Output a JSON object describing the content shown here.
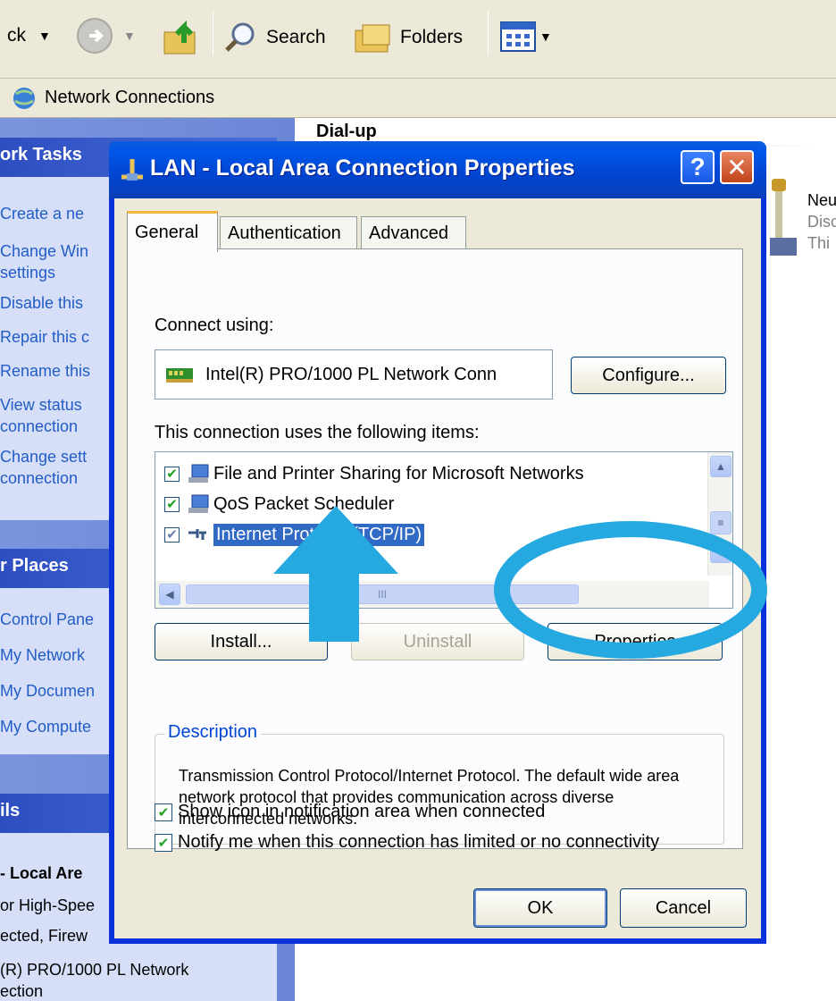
{
  "explorer": {
    "toolbar": {
      "back_label": "ck",
      "search_label": "Search",
      "folders_label": "Folders"
    },
    "address": "Network Connections",
    "taskpane": {
      "tasks_header": "ork Tasks",
      "tasks": [
        "Create a ne",
        "Change Win",
        "settings",
        "Disable this",
        "Repair this c",
        "Rename this",
        "View status",
        "connection",
        "Change sett",
        "connection"
      ],
      "places_header": "r Places",
      "places": [
        "Control Pane",
        "My Network",
        "My Documen",
        "My Compute"
      ],
      "details_header": "ils",
      "details_title": "- Local Are",
      "details_lines": [
        "or High-Spee",
        "ected, Firew",
        "(R) PRO/1000 PL Network",
        "ection"
      ]
    },
    "right": {
      "section_title": "Dial-up",
      "item_name": "Neu",
      "item_status": "Disc",
      "item_type": "Thi"
    }
  },
  "dialog": {
    "title": "LAN - Local Area Connection Properties",
    "help_label": "?",
    "close_label": "✕",
    "tabs": [
      "General",
      "Authentication",
      "Advanced"
    ],
    "connect_using_label": "Connect using:",
    "adapter_name": "Intel(R) PRO/1000 PL Network Conn",
    "configure_label": "Configure...",
    "items_label": "This connection uses the following items:",
    "items": [
      {
        "label": "File and Printer Sharing for Microsoft Networks",
        "checked": true,
        "icon": "network-computer-icon"
      },
      {
        "label": "QoS Packet Scheduler",
        "checked": true,
        "icon": "network-computer-icon"
      },
      {
        "label": "Internet Protocol (TCP/IP)",
        "checked": true,
        "icon": "protocol-icon",
        "selected": true
      }
    ],
    "scroll_middle": "III",
    "install_label": "Install...",
    "uninstall_label": "Uninstall",
    "properties_label": "Properties",
    "description_title": "Description",
    "description_text": "Transmission Control Protocol/Internet Protocol. The default wide area network protocol that provides communication across diverse interconnected networks.",
    "option1_label": "Show icon in notification area when connected",
    "option2_label": "Notify me when this connection has limited or no connectivity",
    "ok_label": "OK",
    "cancel_label": "Cancel"
  },
  "colors": {
    "title_blue": "#0054e3",
    "annotation_blue": "#26a8e0",
    "selection": "#316ac5"
  }
}
